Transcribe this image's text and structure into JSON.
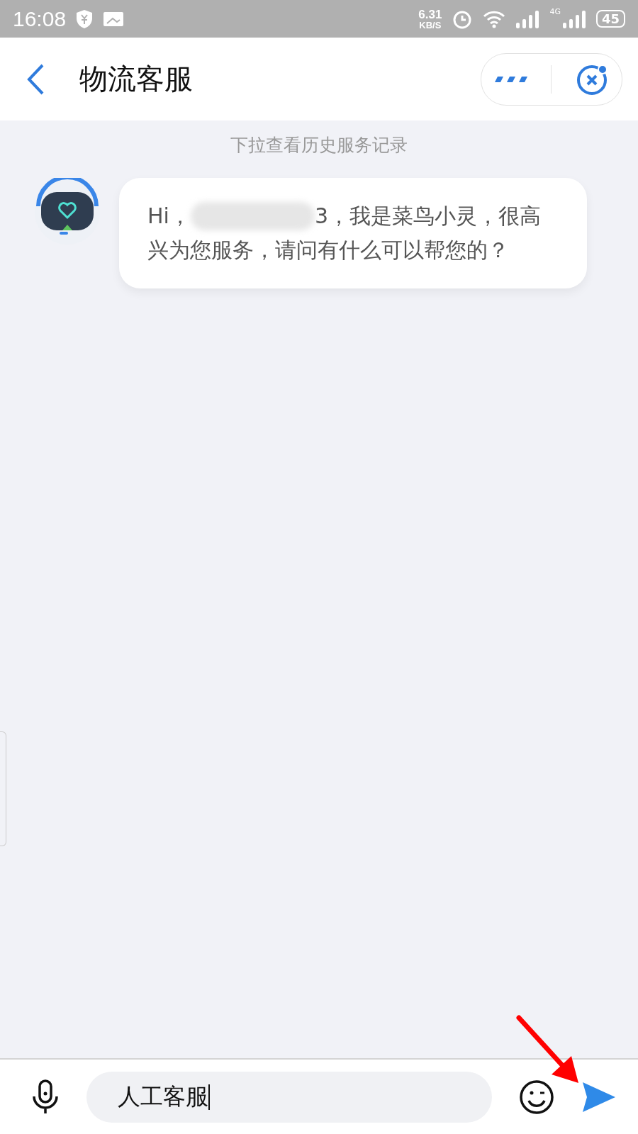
{
  "status_bar": {
    "time": "16:08",
    "speed": "6.31",
    "speed_unit": "KB/S",
    "network": "4G",
    "battery": "45"
  },
  "header": {
    "title": "物流客服"
  },
  "hint": "下拉查看历史服务记录",
  "messages": [
    {
      "kind": "bot",
      "before": "Hi，",
      "redacted": true,
      "after": "3，我是菜鸟小灵，很高",
      "line2": "兴为您服务，请问有什么可以帮您的？"
    }
  ],
  "composer": {
    "value": "人工客服",
    "focused": true
  },
  "annotation": {
    "kind": "arrow"
  }
}
